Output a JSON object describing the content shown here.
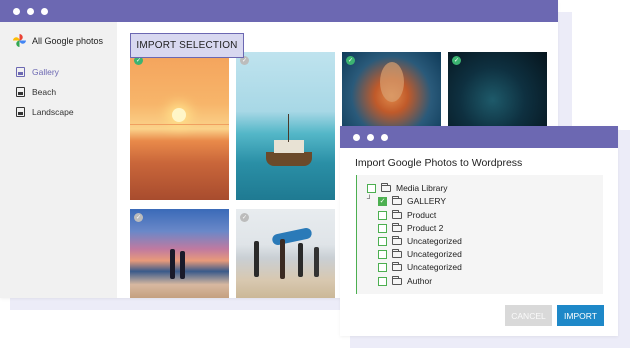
{
  "main_window": {
    "sidebar": {
      "header": "All Google photos",
      "items": [
        {
          "label": "Gallery",
          "active": true
        },
        {
          "label": "Beach",
          "active": false
        },
        {
          "label": "Landscape",
          "active": false
        }
      ]
    },
    "import_selection_label": "IMPORT SELECTION",
    "photos": [
      {
        "subject": "sunset over sea",
        "selected": true
      },
      {
        "subject": "boat on turquoise water",
        "selected": false
      },
      {
        "subject": "underwater diver",
        "selected": true
      },
      {
        "subject": "dark underwater",
        "selected": true
      },
      {
        "subject": "people on beach at dusk",
        "selected": false
      },
      {
        "subject": "surfers with boards",
        "selected": false
      }
    ]
  },
  "dialog": {
    "title": "Import Google Photos to Wordpress",
    "tree": [
      {
        "label": "Media Library",
        "checked": false,
        "level": 0
      },
      {
        "label": "GALLERY",
        "checked": true,
        "level": 0
      },
      {
        "label": "Product",
        "checked": false,
        "level": 1
      },
      {
        "label": "Product 2",
        "checked": false,
        "level": 1
      },
      {
        "label": "Uncategorized",
        "checked": false,
        "level": 1
      },
      {
        "label": "Uncategorized",
        "checked": false,
        "level": 1
      },
      {
        "label": "Uncategorized",
        "checked": false,
        "level": 1
      },
      {
        "label": "Author",
        "checked": false,
        "level": 1
      }
    ],
    "cancel_label": "CANCEL",
    "import_label": "IMPORT"
  },
  "colors": {
    "titlebar": "#6c68b2",
    "accent_green": "#4caf50",
    "import_blue": "#1e88c8"
  }
}
